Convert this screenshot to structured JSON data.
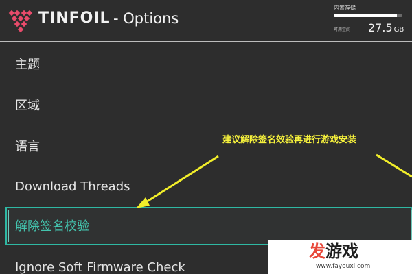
{
  "header": {
    "brand": "TINFOIL",
    "suffix": "- Options",
    "logo_icon": "tinfoil-diamond-logo"
  },
  "storage": {
    "label": "内置存储",
    "used_fraction": 0.92,
    "free_label": "可用空间",
    "free_value": "27.5",
    "free_unit": "GB"
  },
  "menu": {
    "items": [
      {
        "label": "主题"
      },
      {
        "label": "区域"
      },
      {
        "label": "语言"
      },
      {
        "label": "Download Threads"
      },
      {
        "label": "解除签名校验",
        "selected": true
      },
      {
        "label": "Ignore Soft Firmware Check"
      }
    ]
  },
  "annotation": {
    "text": "建议解除签名效验再进行游戏安装"
  },
  "watermark": {
    "brand": "发游戏",
    "url": "www.fayouxi.com"
  },
  "colors": {
    "background": "#2d2d2d",
    "selection": "#2fb8a3",
    "annotation": "#f7f23c",
    "logo": "#e94b6b"
  }
}
